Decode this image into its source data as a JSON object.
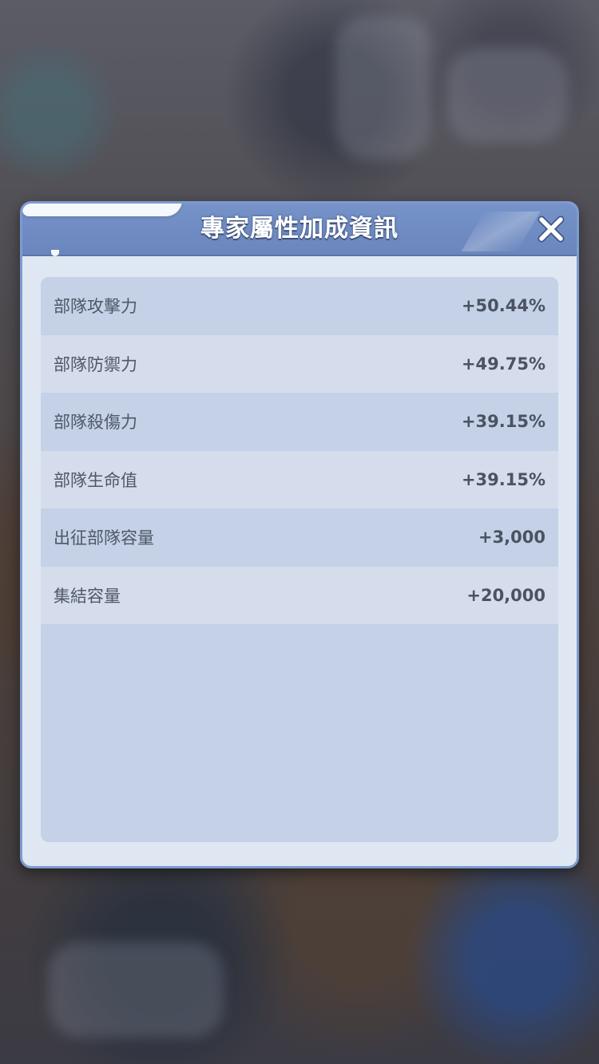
{
  "dialog": {
    "title": "專家屬性加成資訊",
    "close_icon": "close-icon"
  },
  "stats": [
    {
      "label": "部隊攻擊力",
      "value": "+50.44%"
    },
    {
      "label": "部隊防禦力",
      "value": "+49.75%"
    },
    {
      "label": "部隊殺傷力",
      "value": "+39.15%"
    },
    {
      "label": "部隊生命值",
      "value": "+39.15%"
    },
    {
      "label": "出征部隊容量",
      "value": "+3,000"
    },
    {
      "label": "集結容量",
      "value": "+20,000"
    }
  ],
  "colors": {
    "header": "#6f8cc4",
    "panel": "#dfe7f3",
    "row_odd": "#c4d1e6",
    "row_even": "#d5ddec"
  }
}
